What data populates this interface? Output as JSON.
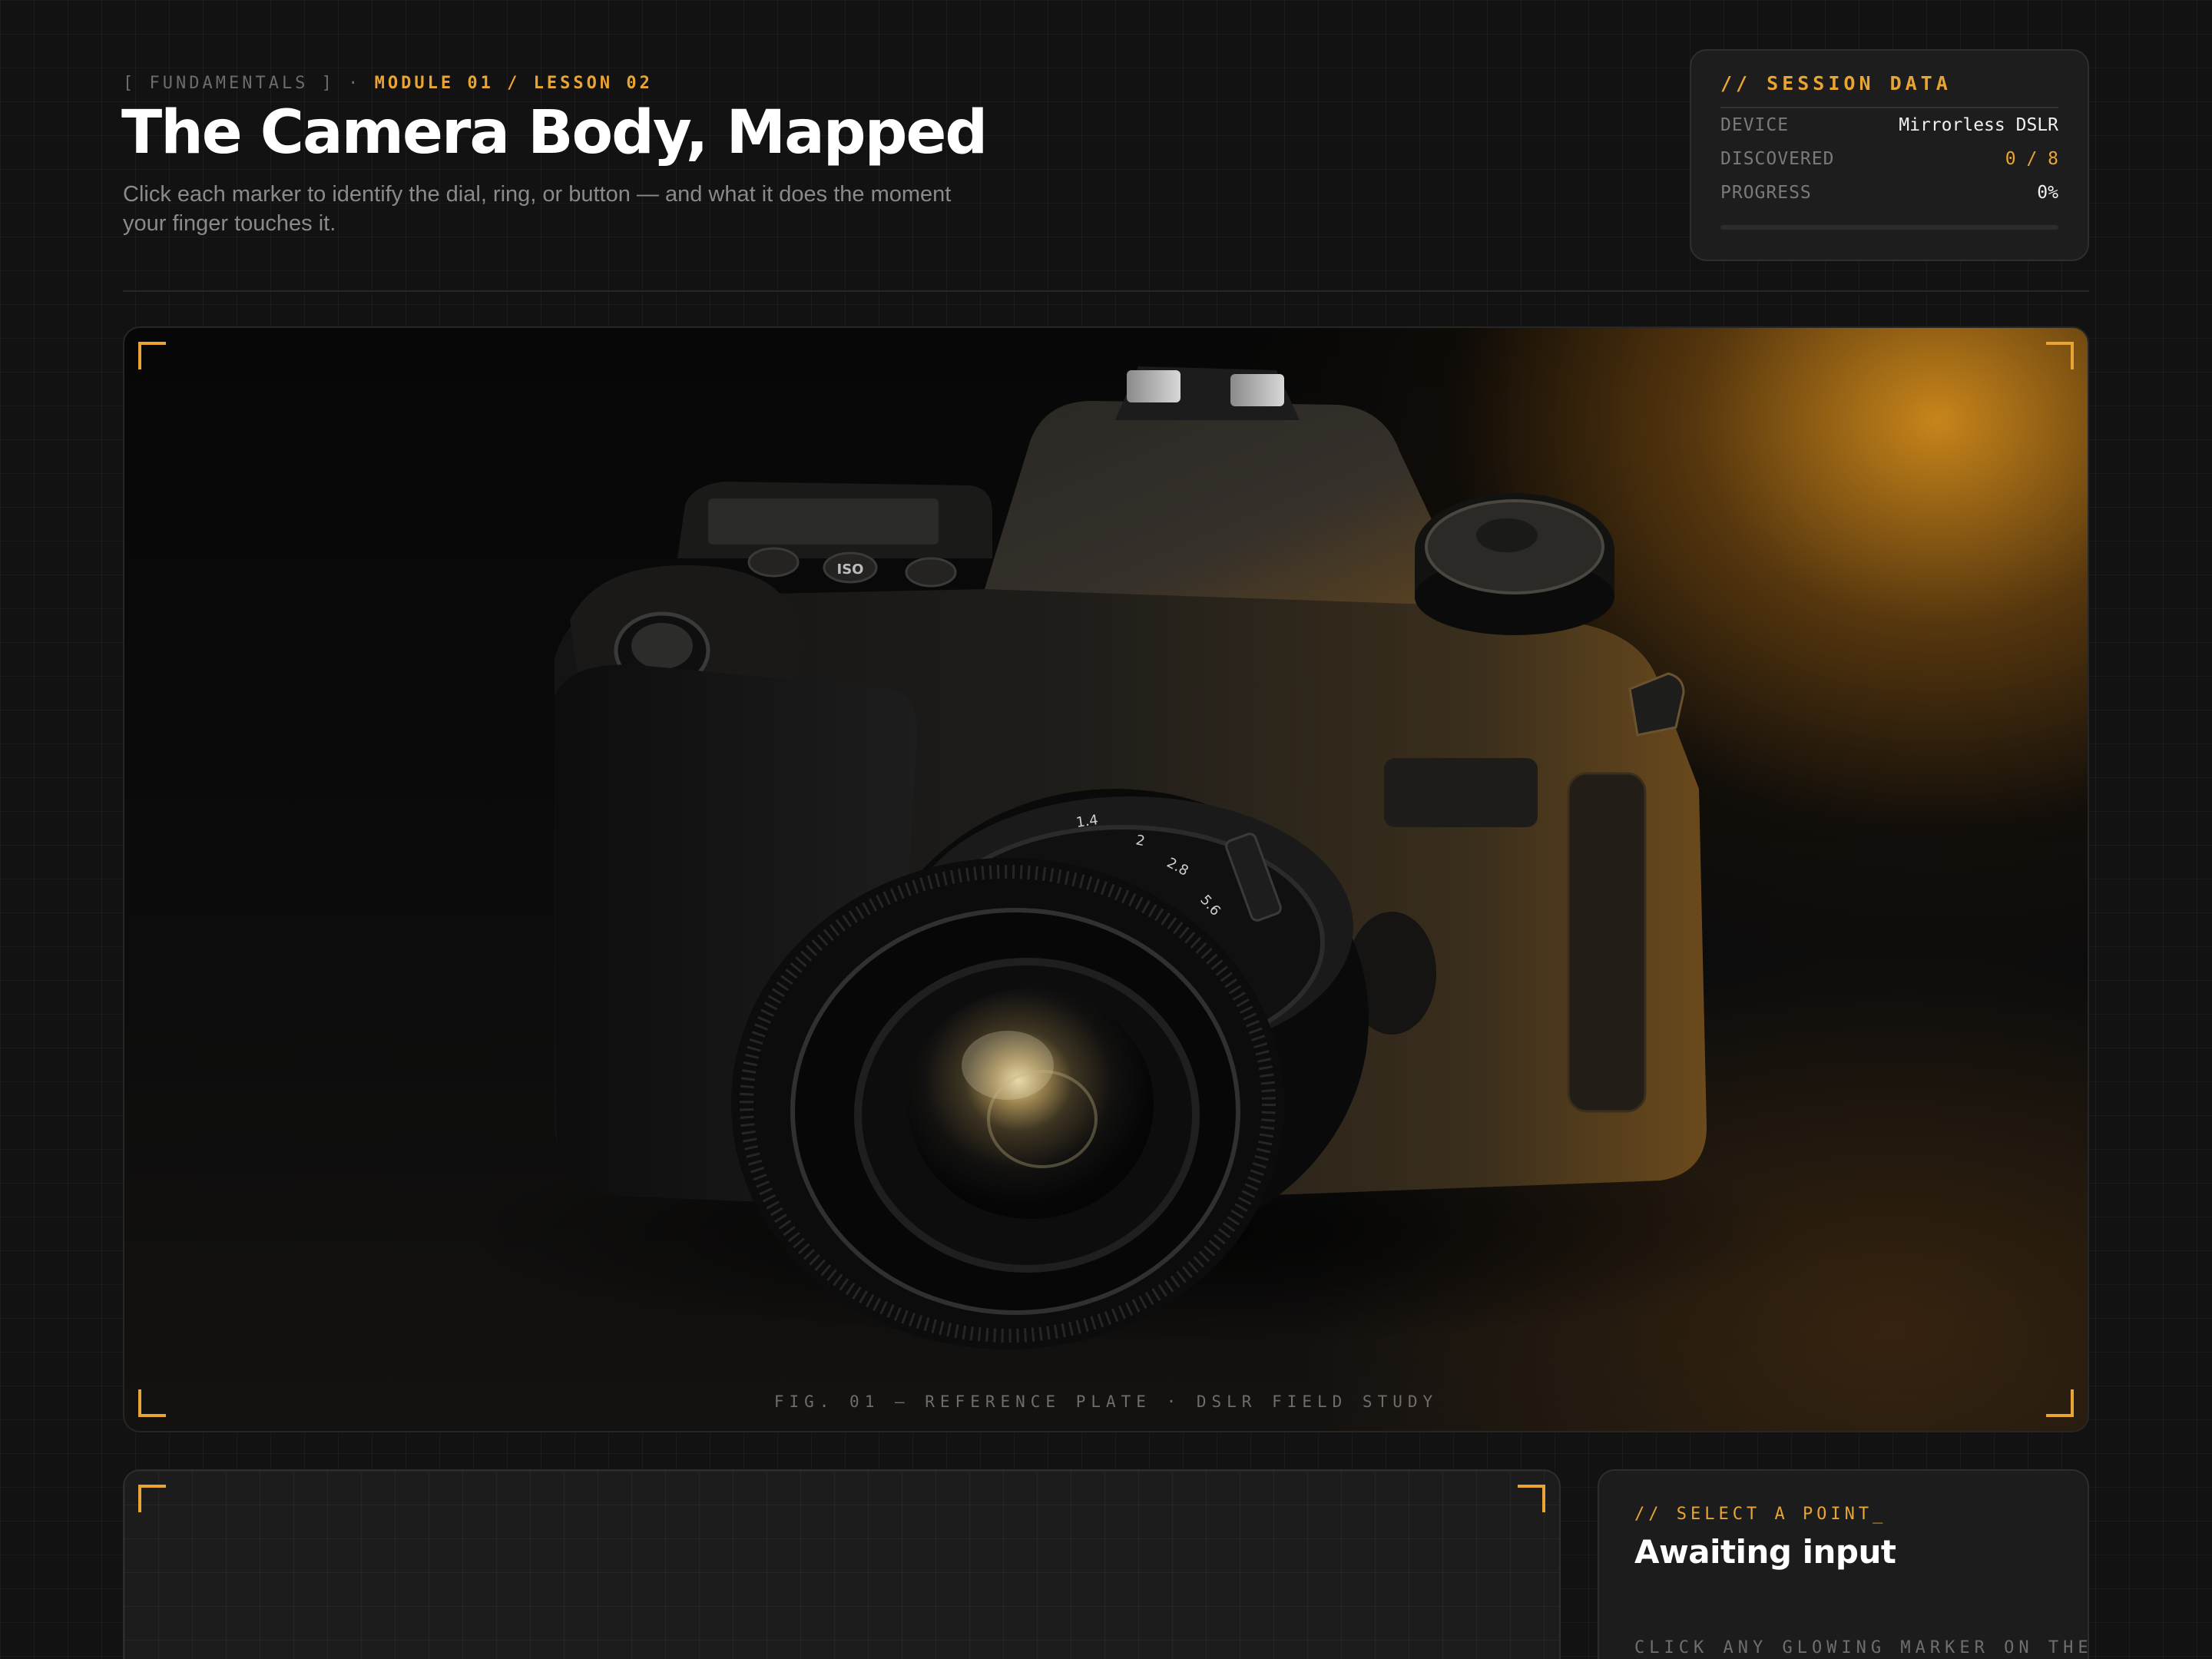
{
  "header": {
    "crumb_prefix": "[ FUNDAMENTALS ] ·",
    "crumb_module": "MODULE 01 / LESSON 02",
    "title": "The Camera Body, Mapped",
    "subtitle": "Click each marker to identify the dial, ring, or button — and what it does the moment your finger touches it."
  },
  "session": {
    "title": "// SESSION DATA",
    "rows": [
      {
        "key": "DEVICE",
        "value": "Mirrorless DSLR"
      },
      {
        "key": "DISCOVERED",
        "value": "0 / 8"
      },
      {
        "key": "PROGRESS",
        "value": "0%"
      }
    ],
    "progress": 0
  },
  "plate": {
    "caption": "FIG. 01 — REFERENCE PLATE · DSLR FIELD STUDY",
    "button_labels": [
      "ISO"
    ],
    "lens_scale": [
      "1.4",
      "2",
      "2.8",
      "5.6"
    ]
  },
  "info_panel": {
    "eyebrow": "// SELECT A POINT_",
    "title": "Awaiting input",
    "hint": "CLICK ANY GLOWING MARKER ON THE"
  },
  "colors": {
    "accent": "#e9a533",
    "background": "#121212",
    "panel": "#1c1c1c"
  }
}
